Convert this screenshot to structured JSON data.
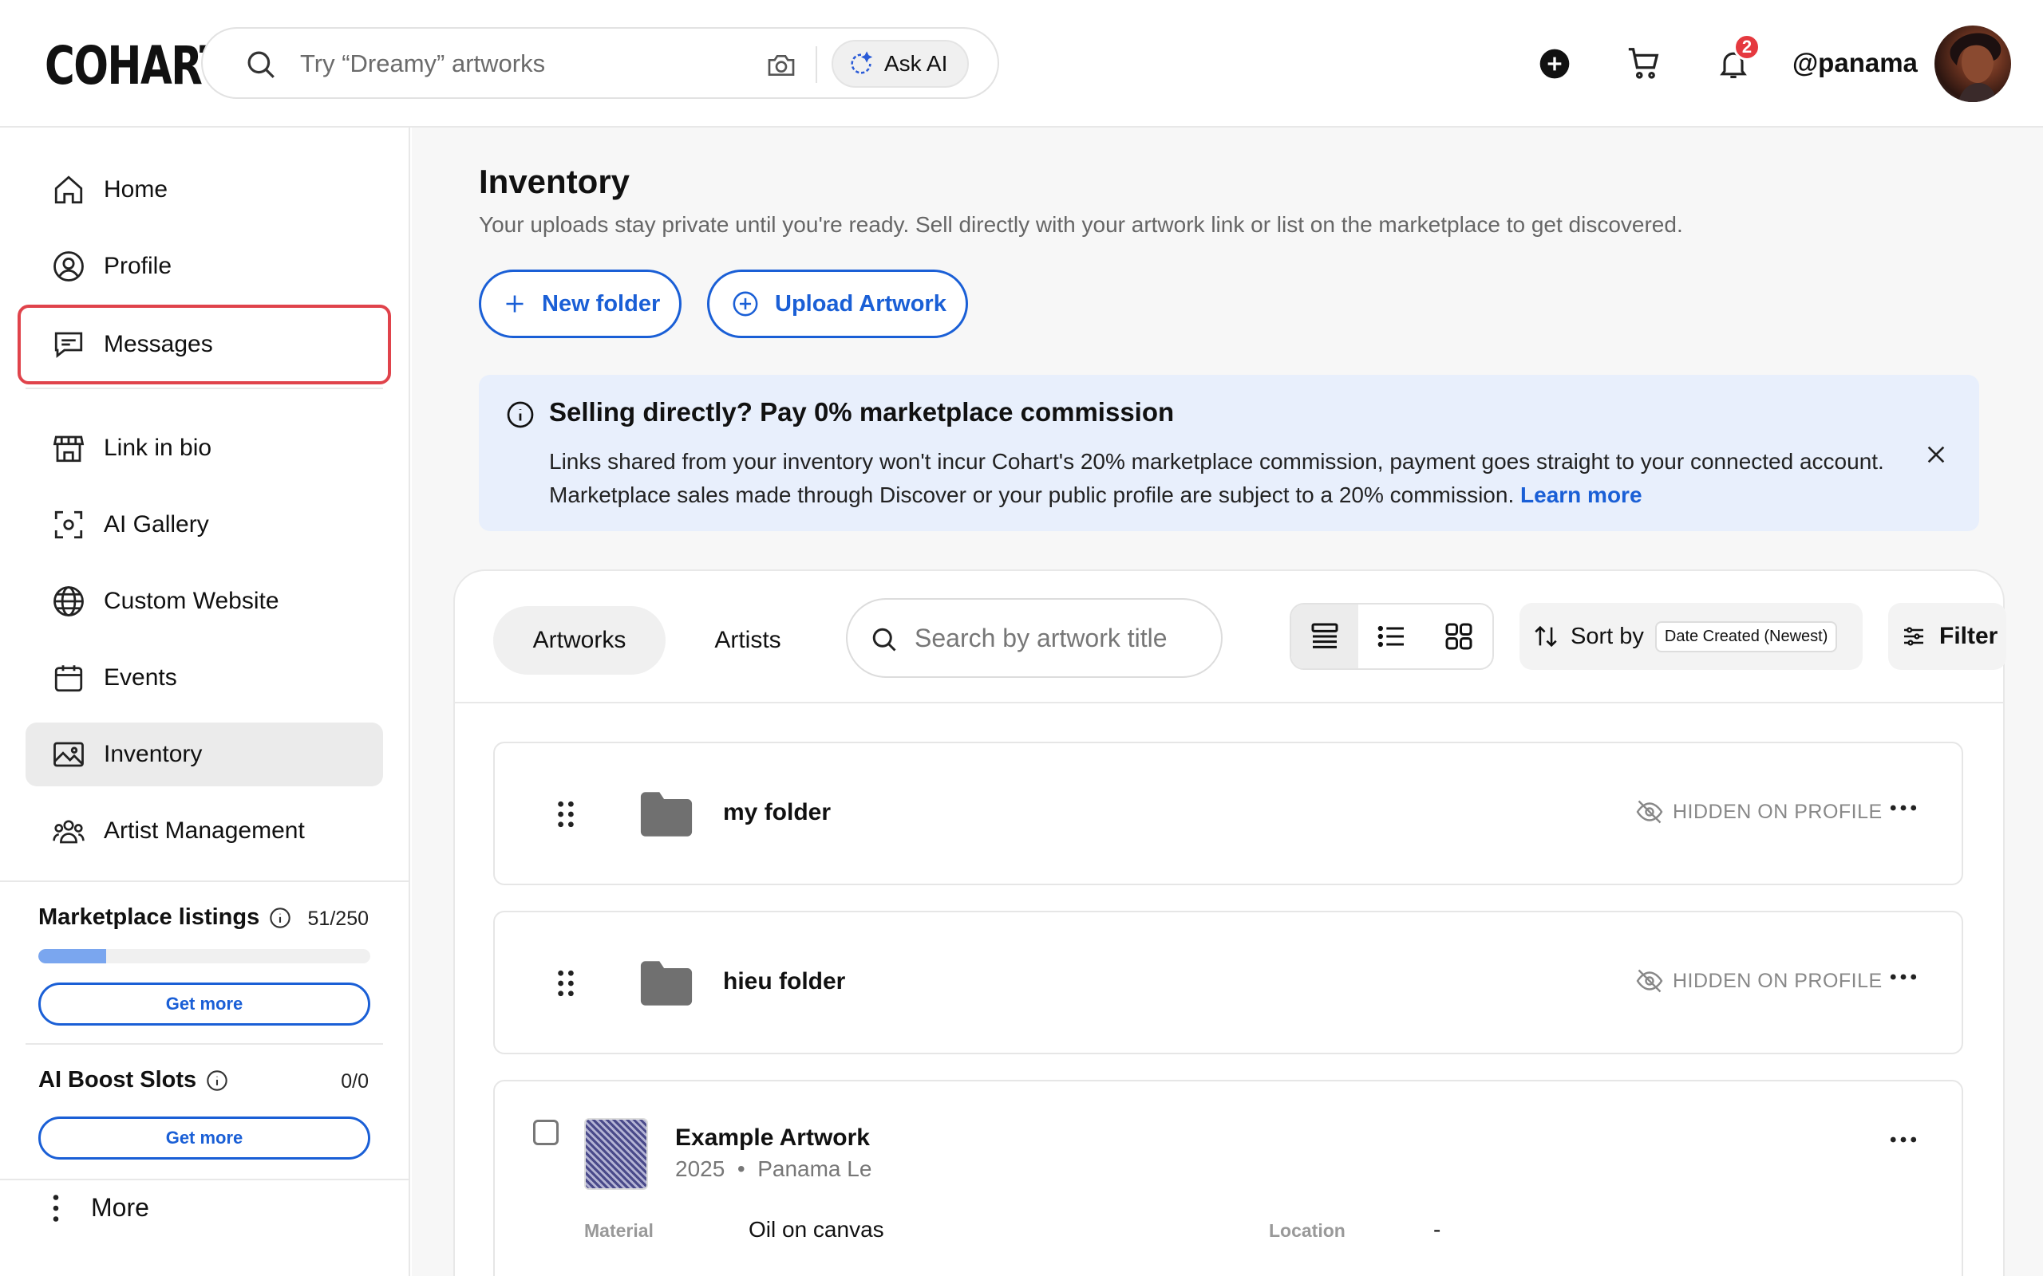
{
  "header": {
    "logo": "COHART",
    "search_placeholder": "Try “Dreamy” artworks",
    "ask_ai": "Ask AI",
    "notifications_count": "2",
    "username": "@panama"
  },
  "sidebar": {
    "items": [
      {
        "label": "Home",
        "icon": "home-icon"
      },
      {
        "label": "Profile",
        "icon": "profile-icon"
      },
      {
        "label": "Messages",
        "icon": "messages-icon"
      },
      {
        "label": "Link in bio",
        "icon": "storefront-icon"
      },
      {
        "label": "AI Gallery",
        "icon": "scan-icon"
      },
      {
        "label": "Custom Website",
        "icon": "globe-icon"
      },
      {
        "label": "Events",
        "icon": "calendar-icon"
      },
      {
        "label": "Inventory",
        "icon": "image-icon"
      },
      {
        "label": "Artist Management",
        "icon": "people-icon"
      }
    ],
    "active": "Inventory",
    "highlighted": "Messages",
    "marketplace": {
      "label": "Marketplace listings",
      "value": "51/250",
      "used": 51,
      "total": 250,
      "button": "Get more"
    },
    "ai_boost": {
      "label": "AI Boost Slots",
      "value": "0/0",
      "button": "Get more"
    },
    "more": "More"
  },
  "main": {
    "title": "Inventory",
    "subtitle": "Your uploads stay private until you're ready. Sell directly with your artwork link or list on the marketplace to get discovered.",
    "new_folder": "New folder",
    "upload_artwork": "Upload Artwork",
    "notice": {
      "title": "Selling directly? Pay 0% marketplace commission",
      "body": "Links shared from your inventory won't incur Cohart's 20% marketplace commission, payment goes straight to your connected account. Marketplace sales made through Discover or your public profile are subject to a 20% commission.",
      "link": "Learn more"
    },
    "tabs": [
      "Artworks",
      "Artists"
    ],
    "active_tab": "Artworks",
    "search_placeholder": "Search by artwork title",
    "sort_label": "Sort by",
    "sort_value": "Date Created (Newest)",
    "filter_label": "Filter",
    "folders": [
      {
        "name": "my folder",
        "status": "HIDDEN ON PROFILE"
      },
      {
        "name": "hieu folder",
        "status": "HIDDEN ON PROFILE"
      }
    ],
    "artwork": {
      "title": "Example Artwork",
      "year": "2025",
      "artist": "Panama Le",
      "material_label": "Material",
      "material": "Oil on canvas",
      "location_label": "Location",
      "location": "-"
    }
  },
  "colors": {
    "accent": "#1a5fd6",
    "highlight": "#e0434b",
    "notice_bg": "#e8effc"
  }
}
